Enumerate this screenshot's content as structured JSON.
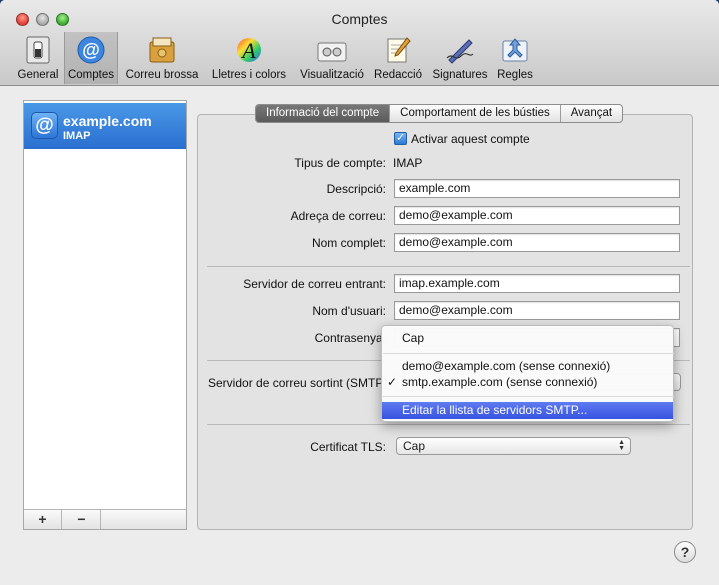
{
  "window": {
    "title": "Comptes"
  },
  "toolbar": {
    "items": [
      {
        "label": "General",
        "icon": "general-switch-icon"
      },
      {
        "label": "Comptes",
        "icon": "at-sign-icon"
      },
      {
        "label": "Correu brossa",
        "icon": "junk-mail-icon"
      },
      {
        "label": "Lletres i colors",
        "icon": "fonts-colors-icon"
      },
      {
        "label": "Visualització",
        "icon": "viewing-icon"
      },
      {
        "label": "Redacció",
        "icon": "composing-icon"
      },
      {
        "label": "Signatures",
        "icon": "signature-pen-icon"
      },
      {
        "label": "Regles",
        "icon": "rules-icon"
      }
    ],
    "selected": "Comptes"
  },
  "accounts": {
    "items": [
      {
        "name": "example.com",
        "type": "IMAP"
      }
    ],
    "add_label": "+",
    "remove_label": "−"
  },
  "tabs": [
    "Informació del compte",
    "Comportament de les bústies",
    "Avançat"
  ],
  "form": {
    "enable_label": "Activar aquest compte",
    "enable_checked": true,
    "account_type_label": "Tipus de compte:",
    "account_type_value": "IMAP",
    "description_label": "Descripció:",
    "description_value": "example.com",
    "email_label": "Adreça de correu:",
    "email_value": "demo@example.com",
    "fullname_label": "Nom complet:",
    "fullname_value": "demo@example.com",
    "incoming_label": "Servidor de correu entrant:",
    "incoming_value": "imap.example.com",
    "username_label": "Nom d'usuari:",
    "username_value": "demo@example.com",
    "password_label": "Contrasenya:",
    "outgoing_label": "Servidor de correu sortint (SMTP):",
    "tls_label": "Certificat TLS:",
    "tls_value": "Cap"
  },
  "smtp_menu": {
    "items": [
      {
        "label": "Cap",
        "checked": false
      },
      {
        "label": "demo@example.com (sense connexió)",
        "checked": false
      },
      {
        "label": "smtp.example.com (sense connexió)",
        "checked": true
      },
      {
        "label": "Editar la llista de servidors SMTP...",
        "highlighted": true
      }
    ],
    "check_mark": "✓"
  },
  "help": {
    "label": "?"
  }
}
